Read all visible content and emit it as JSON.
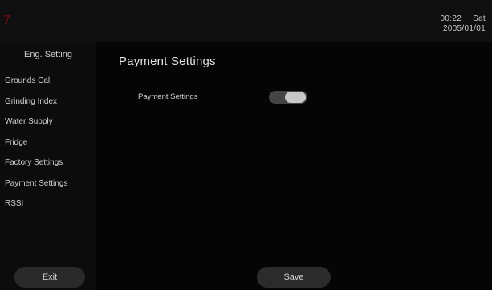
{
  "header": {
    "brand_glyph": "7",
    "time": "00:22",
    "weekday": "Sat",
    "date": "2005/01/01"
  },
  "sidebar": {
    "title": "Eng. Setting",
    "items": [
      {
        "label": "Grounds Cal."
      },
      {
        "label": "Grinding Index"
      },
      {
        "label": "Water Supply"
      },
      {
        "label": "Fridge"
      },
      {
        "label": "Factory Settings"
      },
      {
        "label": "Payment Settings"
      },
      {
        "label": "RSSI"
      }
    ],
    "exit_label": "Exit"
  },
  "main": {
    "title": "Payment Settings",
    "settings": [
      {
        "label": "Payment Settings",
        "toggle_on": true
      }
    ],
    "save_label": "Save"
  },
  "colors": {
    "background": "#000000",
    "toggle_knob": "#c8c8c8",
    "toggle_track": "#444444",
    "button_bg": "#2a2a2a",
    "brand_mark": "#5a1010"
  }
}
